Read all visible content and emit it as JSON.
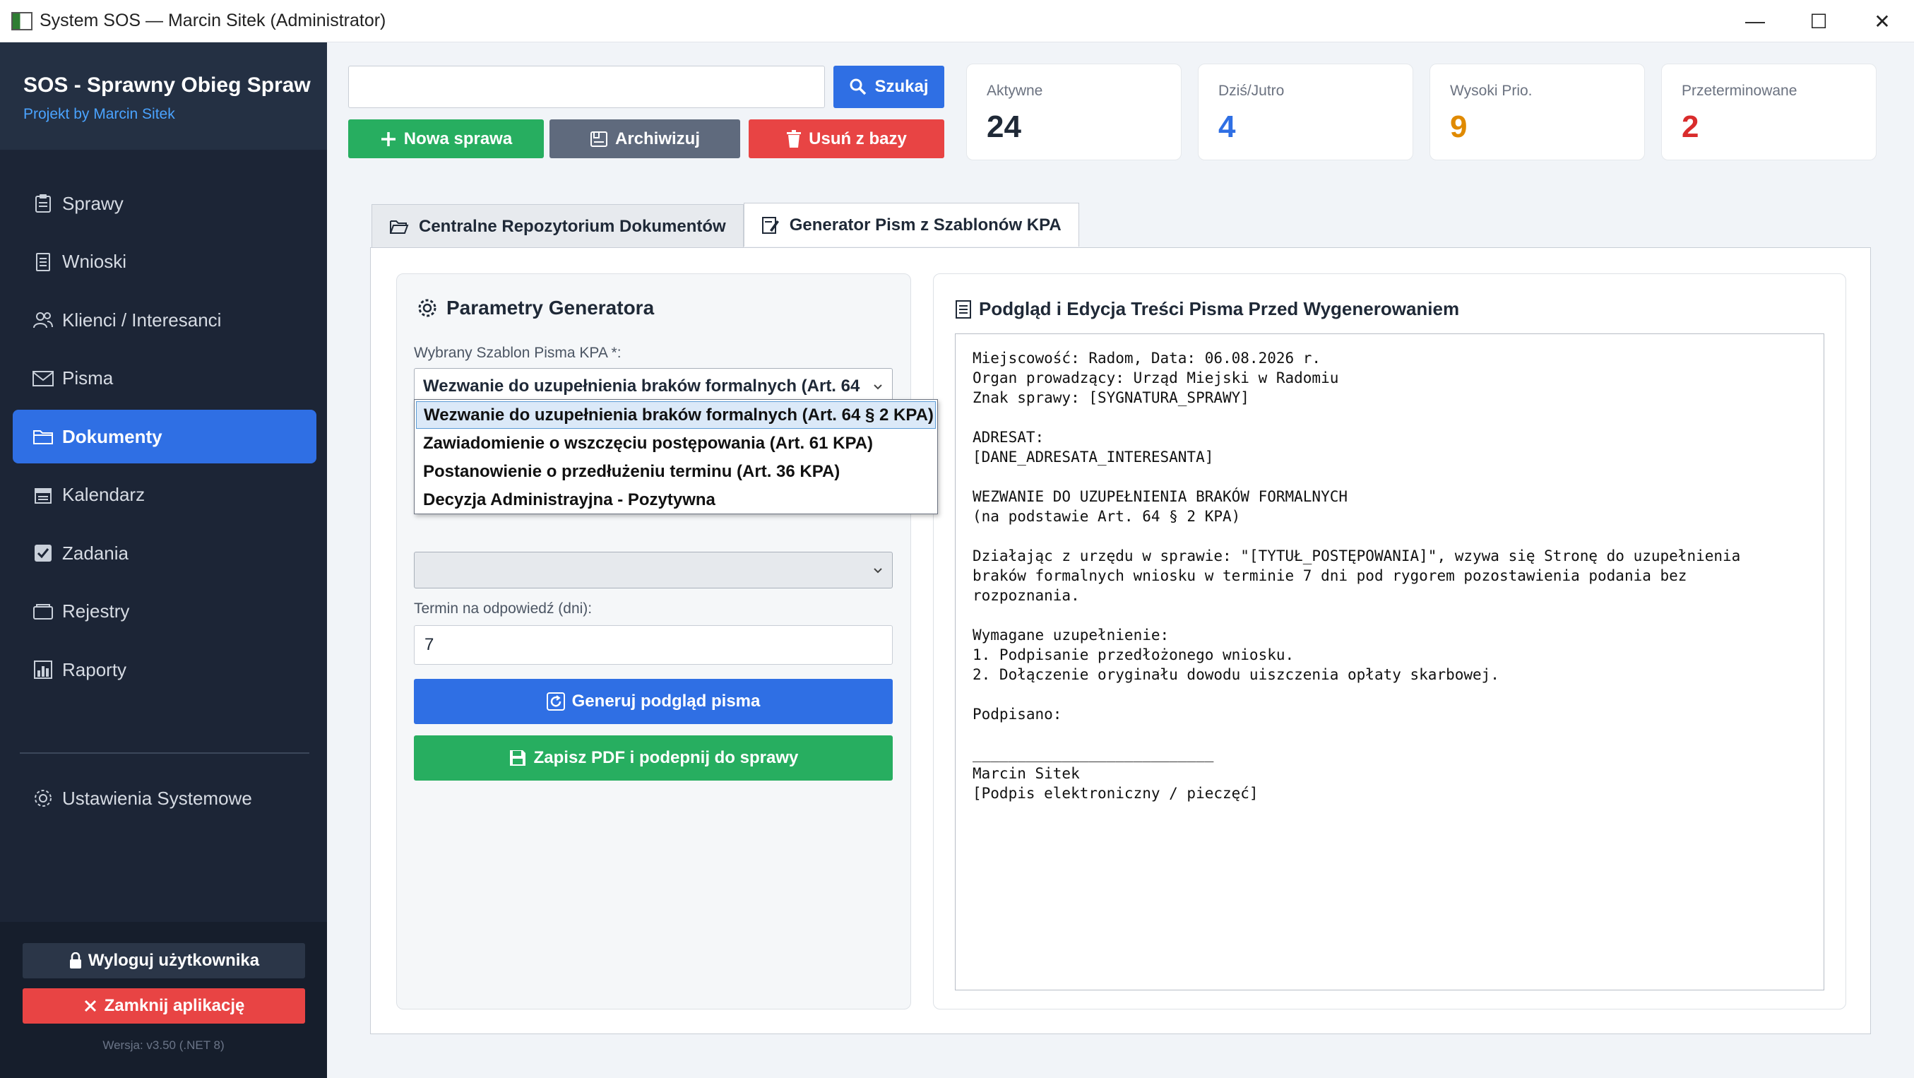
{
  "window": {
    "title": "System SOS — Marcin Sitek (Administrator)",
    "minimize_glyph": "—",
    "maximize_glyph": "☐",
    "close_glyph": "✕"
  },
  "sidebar": {
    "app_name": "SOS - Sprawny Obieg Spraw",
    "app_subtitle": "Projekt by Marcin Sitek",
    "items": [
      {
        "label": "Sprawy",
        "icon": "clipboard-icon"
      },
      {
        "label": "Wnioski",
        "icon": "document-icon"
      },
      {
        "label": "Klienci / Interesanci",
        "icon": "users-icon"
      },
      {
        "label": "Pisma",
        "icon": "envelope-icon"
      },
      {
        "label": "Dokumenty",
        "icon": "folder-icon",
        "active": true
      },
      {
        "label": "Kalendarz",
        "icon": "calendar-icon"
      },
      {
        "label": "Zadania",
        "icon": "checkbox-icon"
      },
      {
        "label": "Rejestry",
        "icon": "register-icon"
      },
      {
        "label": "Raporty",
        "icon": "bar-chart-icon"
      }
    ],
    "settings_label": "Ustawienia Systemowe",
    "logout_label": "Wyloguj użytkownika",
    "close_label": "Zamknij aplikację",
    "version": "Wersja: v3.50 (.NET 8)"
  },
  "toolbar": {
    "search_value": "",
    "search_label": "Szukaj",
    "new_label": "Nowa sprawa",
    "archive_label": "Archiwizuj",
    "delete_label": "Usuń z bazy"
  },
  "stats": [
    {
      "label": "Aktywne",
      "value": "24",
      "color": "#1f2937"
    },
    {
      "label": "Dziś/Jutro",
      "value": "4",
      "color": "#2f6fe4"
    },
    {
      "label": "Wysoki Prio.",
      "value": "9",
      "color": "#e08a00"
    },
    {
      "label": "Przeterminowane",
      "value": "2",
      "color": "#d92c2c"
    }
  ],
  "tabs": [
    {
      "label": "Centralne Repozytorium Dokumentów"
    },
    {
      "label": "Generator Pism z Szablonów KPA"
    }
  ],
  "generator": {
    "title": "Parametry Generatora",
    "template_label": "Wybrany Szablon Pisma KPA *:",
    "template_value": "Wezwanie do uzupełnienia braków formalnych (Art. 64",
    "template_options": [
      "Wezwanie do uzupełnienia braków formalnych (Art. 64 § 2 KPA)",
      "Zawiadomienie o wszczęciu postępowania (Art. 61 KPA)",
      "Postanowienie o przedłużeniu terminu (Art. 36 KPA)",
      "Decyzja Administrayjna - Pozytywna"
    ],
    "second_select_value": "",
    "deadline_label": "Termin na odpowiedź (dni):",
    "deadline_value": "7",
    "generate_label": "Generuj podgląd pisma",
    "save_label": "Zapisz PDF i podepnij do sprawy"
  },
  "preview": {
    "title": "Podgląd i Edycja Treści Pisma Przed Wygenerowaniem",
    "text": "Miejscowość: Radom, Data: 06.08.2026 r.\nOrgan prowadzący: Urząd Miejski w Radomiu\nZnak sprawy: [SYGNATURA_SPRAWY]\n\nADRESAT:\n[DANE_ADRESATA_INTERESANTA]\n\nWEZWANIE DO UZUPEŁNIENIA BRAKÓW FORMALNYCH\n(na podstawie Art. 64 § 2 KPA)\n\nDziałając z urzędu w sprawie: \"[TYTUŁ_POSTĘPOWANIA]\", wzywa się Stronę do uzupełnienia\nbraków formalnych wniosku w terminie 7 dni pod rygorem pozostawienia podania bez\nrozpoznania.\n\nWymagane uzupełnienie:\n1. Podpisanie przedłożonego wniosku.\n2. Dołączenie oryginału dowodu uiszczenia opłaty skarbowej.\n\nPodpisano:\n\n___________________________\nMarcin Sitek\n[Podpis elektroniczny / pieczęć]"
  }
}
